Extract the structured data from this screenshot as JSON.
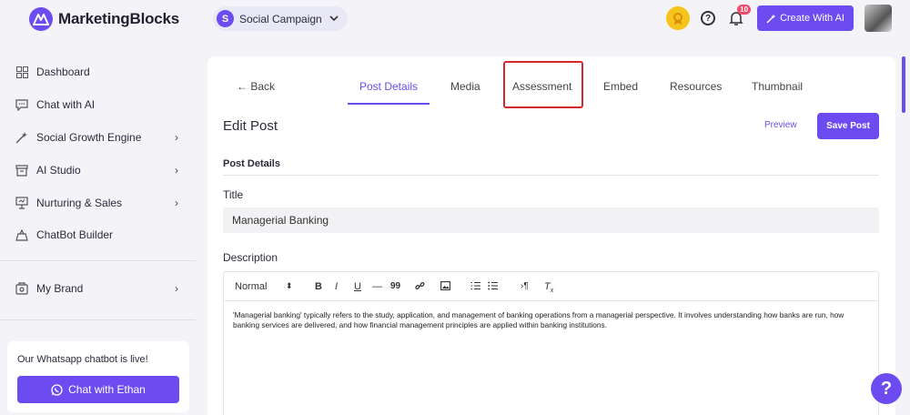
{
  "app": {
    "name": "MarketingBlocks"
  },
  "header": {
    "campaign_initial": "S",
    "campaign_name": "Social Campaign",
    "notification_count": "10",
    "create_label": "Create With AI"
  },
  "sidebar": {
    "items": [
      {
        "label": "Dashboard",
        "icon": "dashboard-icon"
      },
      {
        "label": "Chat with AI",
        "icon": "chat-icon"
      },
      {
        "label": "Social Growth Engine",
        "icon": "magic-wand-icon"
      },
      {
        "label": "AI Studio",
        "icon": "archive-icon"
      },
      {
        "label": "Nurturing & Sales",
        "icon": "presentation-icon"
      },
      {
        "label": "ChatBot Builder",
        "icon": "chatbot-icon"
      },
      {
        "label": "My Brand",
        "icon": "brand-icon"
      }
    ],
    "whatsapp_text": "Our Whatsapp chatbot is live!",
    "whatsapp_button": "Chat with Ethan"
  },
  "tabs": {
    "back": "← Back",
    "items": [
      "Post Details",
      "Media",
      "Assessment",
      "Embed",
      "Resources",
      "Thumbnail"
    ],
    "active": "Post Details"
  },
  "post": {
    "heading": "Edit Post",
    "preview_label": "Preview",
    "save_label": "Save Post",
    "section_title": "Post Details",
    "title_label": "Title",
    "title_value": "Managerial Banking",
    "description_label": "Description",
    "format_select": "Normal",
    "description_text": "'Managerial banking' typically refers to the study, application, and management of banking operations from a managerial perspective. It involves understanding how banks are run, how banking services are delivered, and how financial management principles are applied within banking institutions."
  },
  "toolbar": {
    "bold": "B",
    "italic": "I",
    "underline": "U",
    "hr": "—",
    "quote": "99",
    "link_icon": "link-icon",
    "image_icon": "image-icon",
    "ol_icon": "ordered-list-icon",
    "ul_icon": "bullet-list-icon",
    "rtl_icon": "paragraph-direction-icon",
    "clear_icon": "clear-format-icon"
  },
  "fab": {
    "label": "?"
  },
  "colors": {
    "accent": "#6c4cf1",
    "highlight": "#d9262b"
  }
}
